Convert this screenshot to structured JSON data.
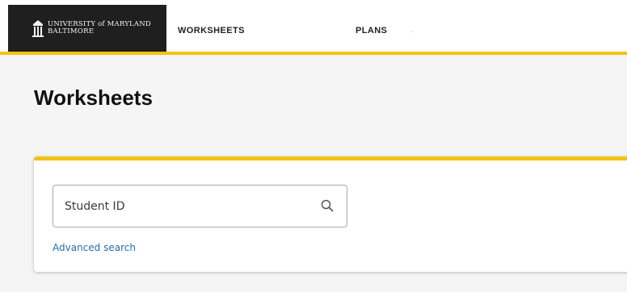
{
  "header": {
    "logo": {
      "line1": "UNIVERSITY of MARYLAND",
      "line2": "BALTIMORE"
    },
    "nav": [
      {
        "label": "WORKSHEETS"
      },
      {
        "label": "PLANS"
      }
    ],
    "accent_color": "#f3c316"
  },
  "main": {
    "title": "Worksheets",
    "search": {
      "placeholder": "Student ID",
      "value": "",
      "icon": "search-icon"
    },
    "advanced_search_label": "Advanced search"
  },
  "colors": {
    "accent": "#f3c316",
    "link": "#1f6fb2",
    "logo_bg": "#1f1f1f"
  }
}
